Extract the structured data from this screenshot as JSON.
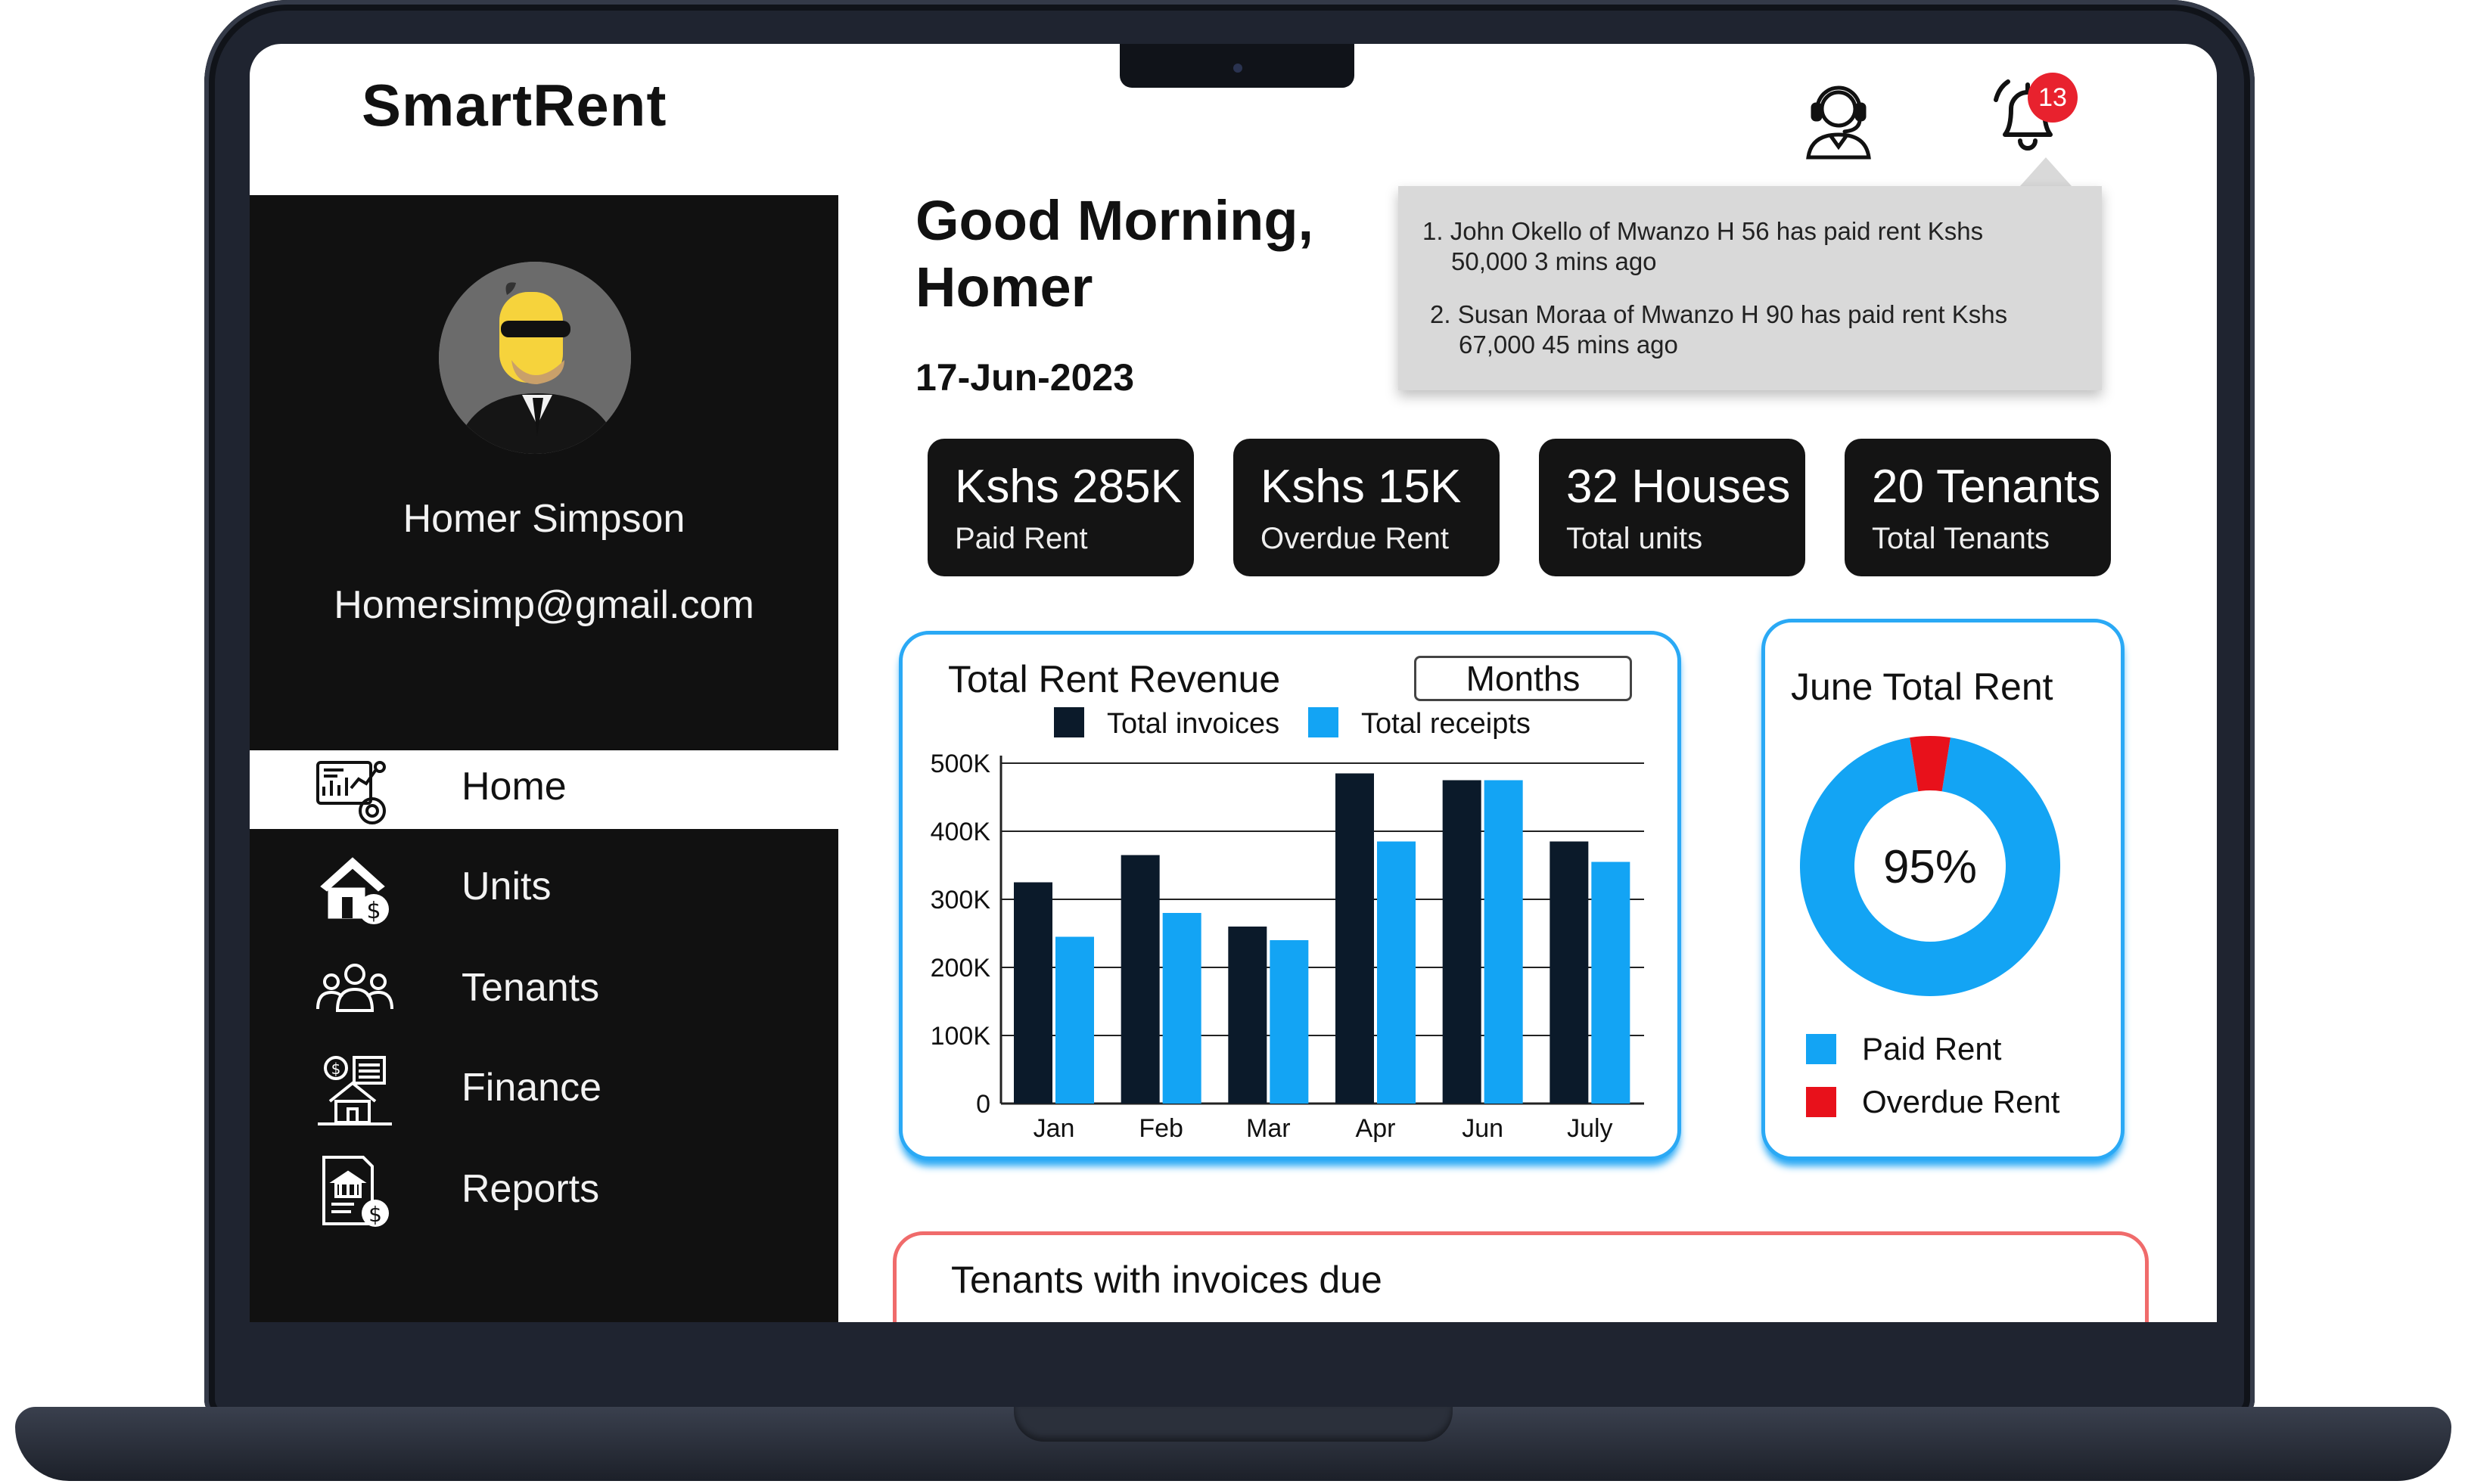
{
  "app": {
    "title": "SmartRent"
  },
  "header": {
    "support_icon": "headset-support-icon",
    "bell_icon": "bell-icon",
    "notification_count": "13"
  },
  "notifications": [
    {
      "line1": "1. John Okello of Mwanzo H 56 has paid rent Kshs",
      "line2": "50,000 3 mins ago"
    },
    {
      "line1": "2.  Susan Moraa of Mwanzo H 90 has paid rent Kshs",
      "line2": "67,000 45 mins ago"
    }
  ],
  "user": {
    "name": "Homer Simpson",
    "email": "Homersimp@gmail.com"
  },
  "nav": [
    {
      "label": "Home",
      "icon": "dashboard-icon",
      "active": true
    },
    {
      "label": "Units",
      "icon": "house-dollar-icon",
      "active": false
    },
    {
      "label": "Tenants",
      "icon": "people-group-icon",
      "active": false
    },
    {
      "label": "Finance",
      "icon": "finance-building-icon",
      "active": false
    },
    {
      "label": "Reports",
      "icon": "report-document-icon",
      "active": false
    }
  ],
  "greeting": {
    "line1": "Good Morning,",
    "line2": "Homer",
    "date": "17-Jun-2023"
  },
  "stats": [
    {
      "value": "Kshs 285K",
      "label": "Paid Rent"
    },
    {
      "value": "Kshs 15K",
      "label": "Overdue Rent"
    },
    {
      "value": "32 Houses",
      "label": "Total units"
    },
    {
      "value": "20 Tenants",
      "label": "Total Tenants"
    }
  ],
  "revenue": {
    "title": "Total Rent Revenue",
    "filter": "Months"
  },
  "donut": {
    "title": "June Total Rent",
    "center_label": "95%",
    "legend_paid": "Paid Rent",
    "legend_overdue": "Overdue Rent"
  },
  "tenants_due": {
    "title": "Tenants with invoices due"
  },
  "colors": {
    "invoices": "#0b1a2a",
    "receipts": "#13a4f4",
    "overdue": "#e8111b",
    "card_border": "#2aa9f5"
  },
  "chart_data": [
    {
      "type": "bar",
      "title": "Total Rent Revenue",
      "categories": [
        "Jan",
        "Feb",
        "Mar",
        "Apr",
        "Jun",
        "July"
      ],
      "series": [
        {
          "name": "Total invoices",
          "values": [
            325000,
            365000,
            260000,
            485000,
            475000,
            385000
          ]
        },
        {
          "name": "Total receipts",
          "values": [
            245000,
            280000,
            240000,
            385000,
            475000,
            355000
          ]
        }
      ],
      "y_ticks": [
        "0",
        "100K",
        "200K",
        "300K",
        "400K",
        "500K"
      ],
      "ylim": [
        0,
        500000
      ],
      "grid": true,
      "legend_position": "top"
    },
    {
      "type": "pie",
      "title": "June Total Rent",
      "labels": [
        "Paid Rent",
        "Overdue Rent"
      ],
      "values": [
        95,
        5
      ],
      "center_label": "95%",
      "legend_position": "bottom"
    }
  ]
}
